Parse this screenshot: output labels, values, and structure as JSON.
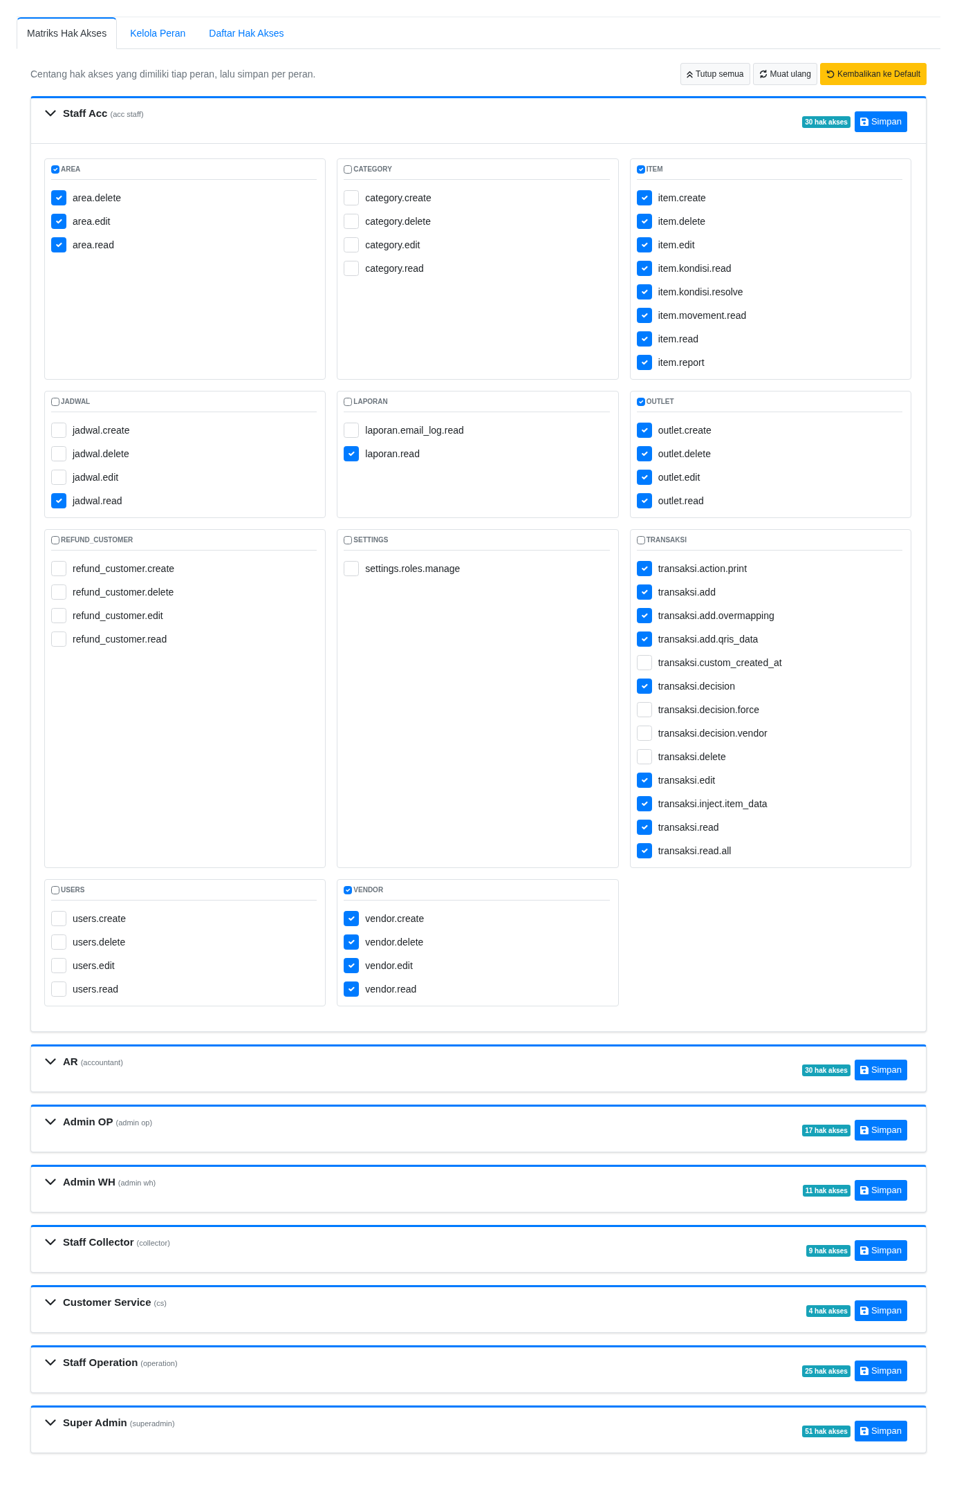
{
  "tabs": [
    {
      "label": "Matriks Hak Akses",
      "selected": true
    },
    {
      "label": "Kelola Peran",
      "selected": false
    },
    {
      "label": "Daftar Hak Akses",
      "selected": false
    }
  ],
  "intro": "Centang hak akses yang dimiliki tiap peran, lalu simpan per peran.",
  "toolbar": [
    {
      "label": "Tutup semua",
      "kind": "collapse"
    },
    {
      "label": "Muat ulang",
      "kind": "reload"
    },
    {
      "label": "Kembalikan ke Default",
      "kind": "reset"
    }
  ],
  "roles": [
    {
      "name": "Staff Acc",
      "code": "(acc staff)",
      "count": "30 hak akses",
      "save": "Simpan",
      "expanded": true,
      "groups": [
        {
          "label": "AREA",
          "checked": true,
          "permissions": [
            {
              "label": "area.delete",
              "checked": true
            },
            {
              "label": "area.edit",
              "checked": true
            },
            {
              "label": "area.read",
              "checked": true
            }
          ]
        },
        {
          "label": "CATEGORY",
          "checked": false,
          "permissions": [
            {
              "label": "category.create",
              "checked": false
            },
            {
              "label": "category.delete",
              "checked": false
            },
            {
              "label": "category.edit",
              "checked": false
            },
            {
              "label": "category.read",
              "checked": false
            }
          ]
        },
        {
          "label": "ITEM",
          "checked": true,
          "permissions": [
            {
              "label": "item.create",
              "checked": true
            },
            {
              "label": "item.delete",
              "checked": true
            },
            {
              "label": "item.edit",
              "checked": true
            },
            {
              "label": "item.kondisi.read",
              "checked": true
            },
            {
              "label": "item.kondisi.resolve",
              "checked": true
            },
            {
              "label": "item.movement.read",
              "checked": true
            },
            {
              "label": "item.read",
              "checked": true
            },
            {
              "label": "item.report",
              "checked": true
            }
          ]
        },
        {
          "label": "JADWAL",
          "checked": false,
          "permissions": [
            {
              "label": "jadwal.create",
              "checked": false
            },
            {
              "label": "jadwal.delete",
              "checked": false
            },
            {
              "label": "jadwal.edit",
              "checked": false
            },
            {
              "label": "jadwal.read",
              "checked": true
            }
          ]
        },
        {
          "label": "LAPORAN",
          "checked": false,
          "permissions": [
            {
              "label": "laporan.email_log.read",
              "checked": false
            },
            {
              "label": "laporan.read",
              "checked": true
            }
          ]
        },
        {
          "label": "OUTLET",
          "checked": true,
          "permissions": [
            {
              "label": "outlet.create",
              "checked": true
            },
            {
              "label": "outlet.delete",
              "checked": true
            },
            {
              "label": "outlet.edit",
              "checked": true
            },
            {
              "label": "outlet.read",
              "checked": true
            }
          ]
        },
        {
          "label": "REFUND_CUSTOMER",
          "checked": false,
          "permissions": [
            {
              "label": "refund_customer.create",
              "checked": false
            },
            {
              "label": "refund_customer.delete",
              "checked": false
            },
            {
              "label": "refund_customer.edit",
              "checked": false
            },
            {
              "label": "refund_customer.read",
              "checked": false
            }
          ]
        },
        {
          "label": "SETTINGS",
          "checked": false,
          "permissions": [
            {
              "label": "settings.roles.manage",
              "checked": false
            }
          ]
        },
        {
          "label": "TRANSAKSI",
          "checked": false,
          "permissions": [
            {
              "label": "transaksi.action.print",
              "checked": true
            },
            {
              "label": "transaksi.add",
              "checked": true
            },
            {
              "label": "transaksi.add.overmapping",
              "checked": true
            },
            {
              "label": "transaksi.add.qris_data",
              "checked": true
            },
            {
              "label": "transaksi.custom_created_at",
              "checked": false
            },
            {
              "label": "transaksi.decision",
              "checked": true
            },
            {
              "label": "transaksi.decision.force",
              "checked": false
            },
            {
              "label": "transaksi.decision.vendor",
              "checked": false
            },
            {
              "label": "transaksi.delete",
              "checked": false
            },
            {
              "label": "transaksi.edit",
              "checked": true
            },
            {
              "label": "transaksi.inject.item_data",
              "checked": true
            },
            {
              "label": "transaksi.read",
              "checked": true
            },
            {
              "label": "transaksi.read.all",
              "checked": true
            }
          ]
        },
        {
          "label": "USERS",
          "checked": false,
          "permissions": [
            {
              "label": "users.create",
              "checked": false
            },
            {
              "label": "users.delete",
              "checked": false
            },
            {
              "label": "users.edit",
              "checked": false
            },
            {
              "label": "users.read",
              "checked": false
            }
          ]
        },
        {
          "label": "VENDOR",
          "checked": true,
          "permissions": [
            {
              "label": "vendor.create",
              "checked": true
            },
            {
              "label": "vendor.delete",
              "checked": true
            },
            {
              "label": "vendor.edit",
              "checked": true
            },
            {
              "label": "vendor.read",
              "checked": true
            }
          ]
        }
      ]
    },
    {
      "name": "AR",
      "code": "(accountant)",
      "count": "30 hak akses",
      "save": "Simpan",
      "expanded": false
    },
    {
      "name": "Admin OP",
      "code": "(admin op)",
      "count": "17 hak akses",
      "save": "Simpan",
      "expanded": false
    },
    {
      "name": "Admin WH",
      "code": "(admin wh)",
      "count": "11 hak akses",
      "save": "Simpan",
      "expanded": false
    },
    {
      "name": "Staff Collector",
      "code": "(collector)",
      "count": "9 hak akses",
      "save": "Simpan",
      "expanded": false
    },
    {
      "name": "Customer Service",
      "code": "(cs)",
      "count": "4 hak akses",
      "save": "Simpan",
      "expanded": false
    },
    {
      "name": "Staff Operation",
      "code": "(operation)",
      "count": "25 hak akses",
      "save": "Simpan",
      "expanded": false
    },
    {
      "name": "Super Admin",
      "code": "(superadmin)",
      "count": "51 hak akses",
      "save": "Simpan",
      "expanded": false
    }
  ]
}
